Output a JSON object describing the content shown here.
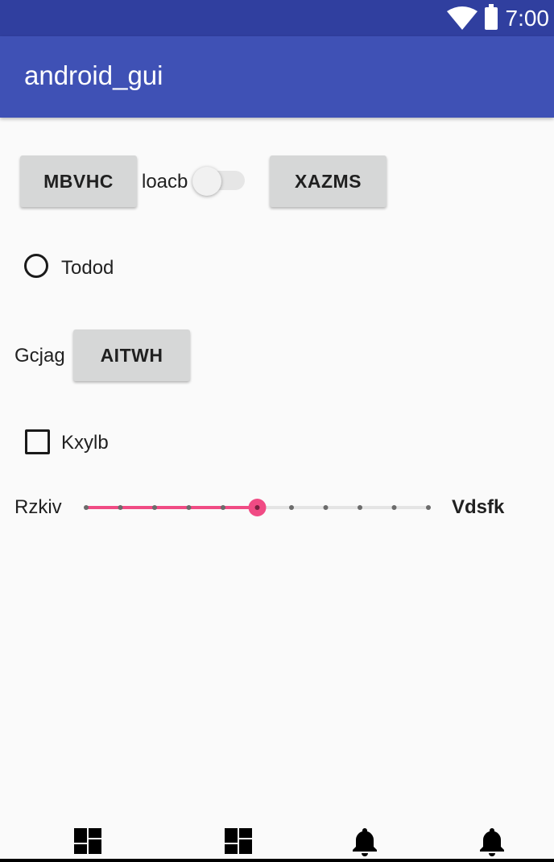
{
  "status_bar": {
    "time": "7:00",
    "icons": [
      "wifi-icon",
      "battery-icon"
    ]
  },
  "app_bar": {
    "title": "android_gui"
  },
  "row1": {
    "button_left": "MBVHC",
    "switch_label": "loacb",
    "switch_on": false,
    "button_right": "XAZMS"
  },
  "radio": {
    "label": "Todod",
    "checked": false
  },
  "row3": {
    "label": "Gcjag",
    "button": "AITWH"
  },
  "checkbox": {
    "label": "Kxylb",
    "checked": false
  },
  "seekbar": {
    "start_label": "Rzkiv",
    "end_label": "Vdsfk",
    "value": 5,
    "max": 10
  },
  "bottom_nav": {
    "items": [
      "dashboard-icon",
      "dashboard-icon",
      "notifications-icon",
      "notifications-icon"
    ]
  },
  "colors": {
    "status_bar": "#303f9f",
    "app_bar": "#3f51b5",
    "accent": "#f04b84",
    "background": "#fafafa",
    "button": "#d6d7d7"
  }
}
